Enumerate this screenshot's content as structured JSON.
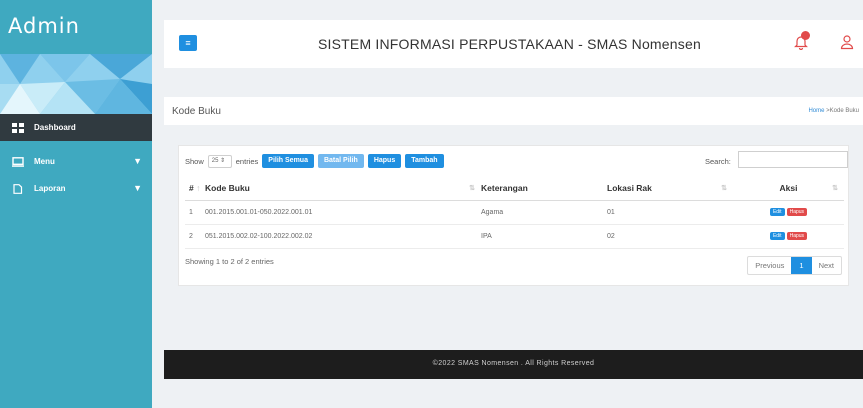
{
  "sidebar": {
    "brand": "Admin",
    "items": [
      {
        "label": "Dashboard",
        "icon": "grid-icon"
      },
      {
        "label": "Menu",
        "icon": "monitor-icon"
      },
      {
        "label": "Laporan",
        "icon": "document-icon"
      }
    ]
  },
  "header": {
    "title": "SISTEM INFORMASI PERPUSTAKAAN - SMAS Nomensen"
  },
  "page": {
    "title": "Kode Buku",
    "breadcrumb_home": "Home",
    "breadcrumb_sep": " >",
    "breadcrumb_current": "Kode Buku"
  },
  "table_controls": {
    "show_label": "Show",
    "entries_value": "25",
    "entries_label": "entries",
    "buttons": [
      "Pilih Semua",
      "Batal Pilih",
      "Hapus",
      "Tambah"
    ],
    "search_label": "Search:"
  },
  "table": {
    "headers": [
      "#",
      "Kode Buku",
      "Keterangan",
      "Lokasi Rak",
      "Aksi"
    ],
    "rows": [
      {
        "no": "1",
        "kode": "001.2015.001.01-050.2022.001.01",
        "ket": "Agama",
        "lok": "01"
      },
      {
        "no": "2",
        "kode": "051.2015.002.02-100.2022.002.02",
        "ket": "IPA",
        "lok": "02"
      }
    ],
    "edit_label": "Edit",
    "delete_label": "Hapus",
    "info": "Showing 1 to 2 of 2 entries",
    "pager": {
      "prev": "Previous",
      "current": "1",
      "next": "Next"
    }
  },
  "footer": {
    "text": "©2022 SMAS Nomensen . All Rights Reserved"
  },
  "colors": {
    "sidebar": "#3fa9c0",
    "active_nav": "#303a40",
    "primary": "#1f8fe0",
    "danger": "#e14a4a",
    "footer": "#1d1d1d"
  }
}
